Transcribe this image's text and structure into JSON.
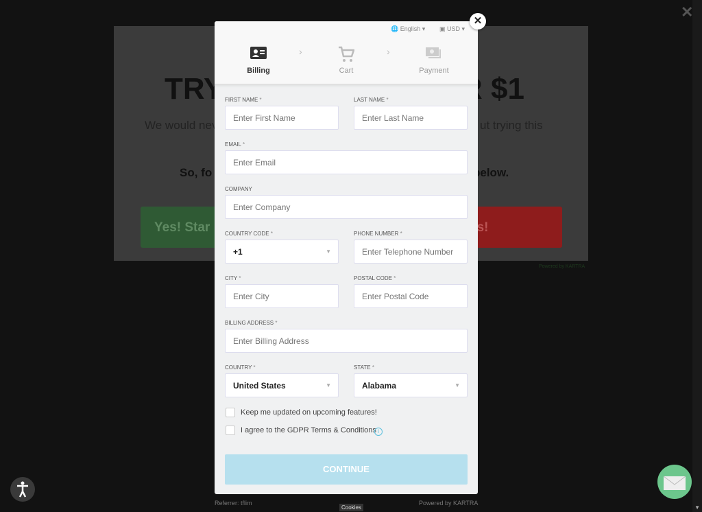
{
  "background": {
    "headline_left": "TRY",
    "headline_right": "R $1",
    "subtitle_left": "We would nev",
    "subtitle_right": "ut trying this",
    "bold_left": "So, fo",
    "bold_right": "below.",
    "yes_button": "Yes! Star",
    "no_button": "ks!",
    "powered": "Powered by KARTRA",
    "colors": {
      "yes": "#2f5a34",
      "no": "#8e1c1c"
    }
  },
  "modal": {
    "language": "English",
    "currency": "USD",
    "steps": [
      {
        "label": "Billing",
        "icon": "id-card-icon",
        "active": true
      },
      {
        "label": "Cart",
        "icon": "cart-icon",
        "active": false
      },
      {
        "label": "Payment",
        "icon": "money-icon",
        "active": false
      }
    ],
    "fields": {
      "first_name": {
        "label": "First Name",
        "req": "*",
        "placeholder": "Enter First Name"
      },
      "last_name": {
        "label": "Last Name",
        "req": "*",
        "placeholder": "Enter Last Name"
      },
      "email": {
        "label": "Email",
        "req": "*",
        "placeholder": "Enter Email"
      },
      "company": {
        "label": "Company",
        "placeholder": "Enter Company"
      },
      "country_code": {
        "label": "Country Code",
        "req": "*",
        "value": "+1"
      },
      "phone": {
        "label": "Phone Number",
        "req": "*",
        "placeholder": "Enter Telephone Number"
      },
      "city": {
        "label": "City",
        "req": "*",
        "placeholder": "Enter City"
      },
      "postal": {
        "label": "Postal Code",
        "req": "*",
        "placeholder": "Enter Postal Code"
      },
      "address": {
        "label": "Billing Address",
        "req": "*",
        "placeholder": "Enter Billing Address"
      },
      "country": {
        "label": "Country",
        "req": "*",
        "value": "United States"
      },
      "state": {
        "label": "State",
        "req": "*",
        "value": "Alabama"
      }
    },
    "checkbox_updates": "Keep me updated on upcoming features!",
    "checkbox_gdpr": "I agree to the GDPR Terms & Conditions",
    "continue": "CONTINUE"
  },
  "footer": {
    "referrer": "Referrer: tflim",
    "powered": "Powered by KARTRA",
    "cookies": "Cookies"
  }
}
